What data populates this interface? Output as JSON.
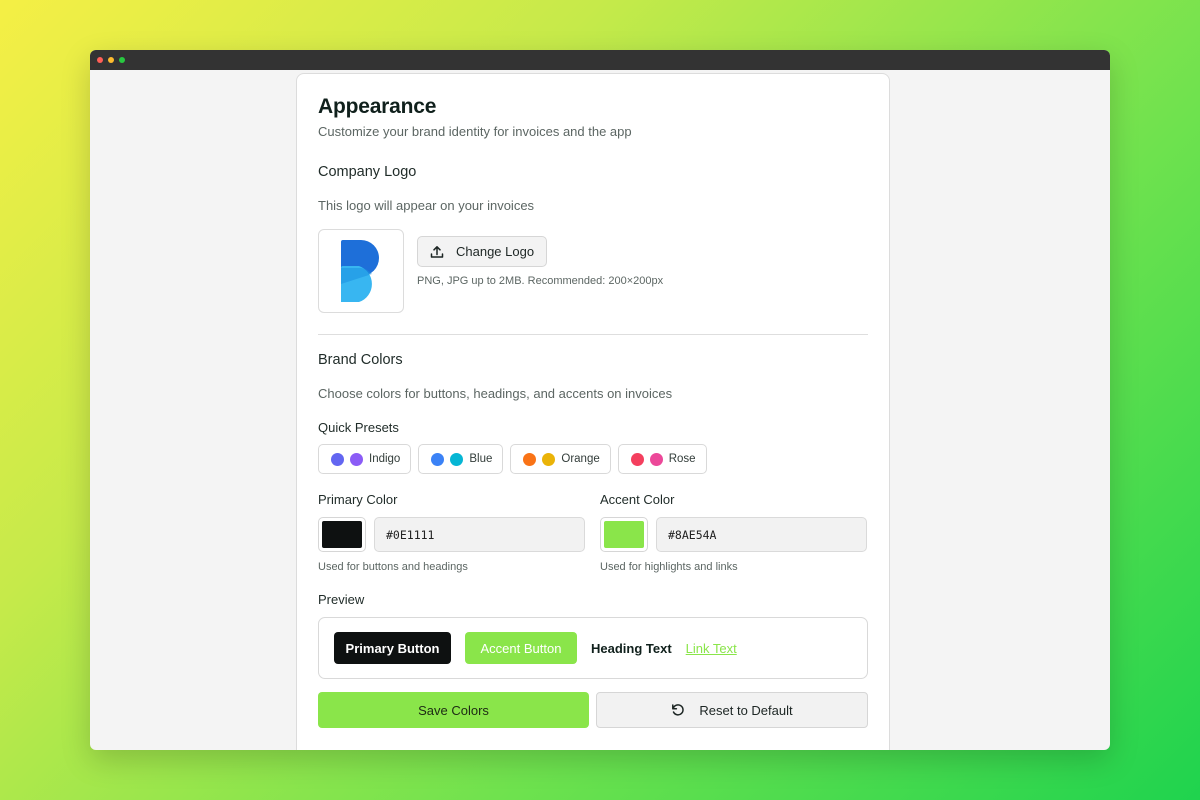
{
  "window": {
    "controls": [
      "close",
      "minimize",
      "maximize"
    ]
  },
  "header": {
    "title": "Appearance",
    "subtitle": "Customize your brand identity for invoices and the app"
  },
  "logo_section": {
    "title": "Company Logo",
    "description": "This logo will appear on your invoices",
    "change_button": "Change Logo",
    "change_icon": "upload-icon",
    "hint": "PNG, JPG up to 2MB. Recommended: 200×200px"
  },
  "brand_colors": {
    "title": "Brand Colors",
    "description": "Choose colors for buttons, headings, and accents on invoices",
    "presets_label": "Quick Presets",
    "presets": [
      {
        "label": "Indigo",
        "colors": [
          "#6366f1",
          "#8b5cf6"
        ]
      },
      {
        "label": "Blue",
        "colors": [
          "#3b82f6",
          "#06b6d4"
        ]
      },
      {
        "label": "Orange",
        "colors": [
          "#f97316",
          "#eab308"
        ]
      },
      {
        "label": "Rose",
        "colors": [
          "#f43f5e",
          "#ec4899"
        ]
      }
    ],
    "primary": {
      "label": "Primary Color",
      "value": "#0E1111",
      "hint": "Used for buttons and headings"
    },
    "accent": {
      "label": "Accent Color",
      "value": "#8AE54A",
      "hint": "Used for highlights and links"
    }
  },
  "preview": {
    "label": "Preview",
    "primary_button": "Primary Button",
    "accent_button": "Accent Button",
    "heading_text": "Heading Text",
    "link_text": "Link Text"
  },
  "actions": {
    "save": "Save Colors",
    "reset": "Reset to Default",
    "reset_icon": "rotate-ccw-icon"
  }
}
